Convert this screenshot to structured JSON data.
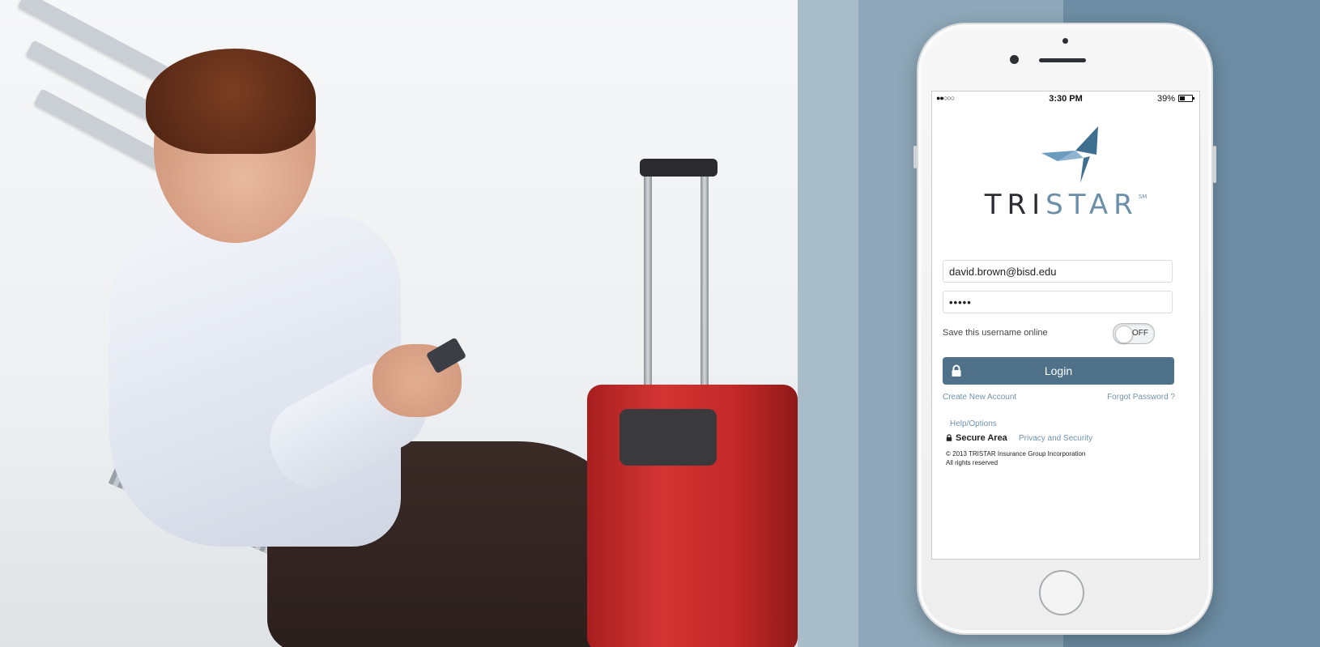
{
  "status_bar": {
    "signal": "●●○○○",
    "time": "3:30 PM",
    "battery": "39%"
  },
  "brand": {
    "name_part1": "TRI",
    "name_part2": "STAR",
    "trademark": "SM"
  },
  "login_form": {
    "username_value": "david.brown@bisd.edu",
    "password_value": "•••••",
    "save_username_label": "Save this username online",
    "save_toggle_state": "OFF",
    "login_button_label": "Login",
    "create_account_link": "Create New Account",
    "forgot_password_link": "Forgot Password ?",
    "help_link": "Help/Options",
    "secure_area_label": "Secure Area",
    "privacy_link": "Privacy and Security",
    "copyright_line1": "© 2013 TRISTAR Insurance Group Incorporation",
    "copyright_line2": "All rights reserved"
  },
  "colors": {
    "accent": "#4f7189",
    "link": "#6f93ad",
    "panel_light": "#a9bcc9",
    "panel_mid": "#8ea8b9",
    "panel_dark": "#6d8da4"
  }
}
